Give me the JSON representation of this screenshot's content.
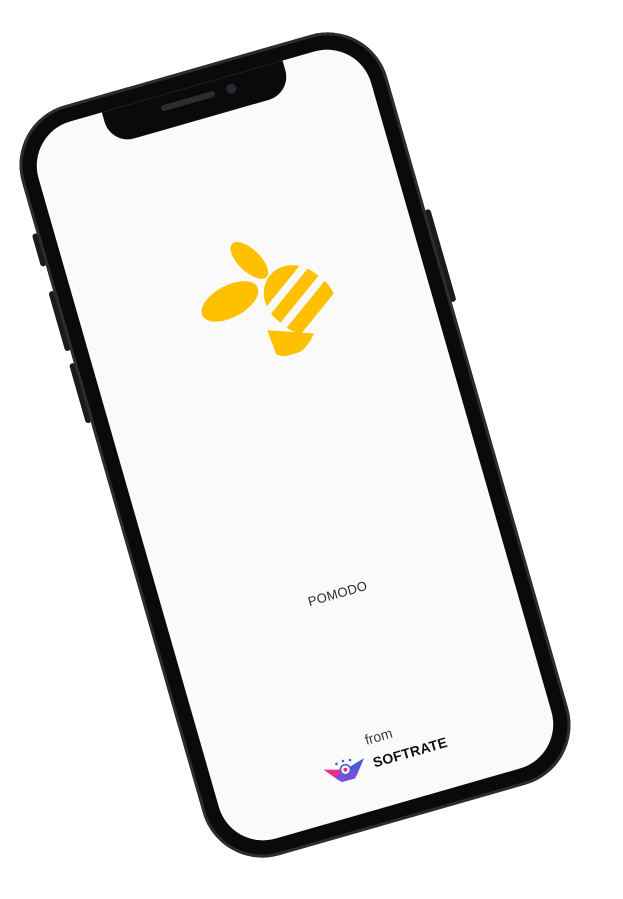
{
  "app": {
    "name": "POMODO",
    "logo_icon": "bee-icon",
    "brand_color": "#FFC000"
  },
  "footer": {
    "from_label": "from",
    "company_name": "SOFTRATE",
    "company_logo_icon": "softrate-logo-icon",
    "company_logo_colors": [
      "#E8308A",
      "#4A5BD6",
      "#7C4DDB"
    ]
  },
  "device": {
    "frame_color": "#0A0A0A",
    "screen_color": "#FAFAFA"
  }
}
